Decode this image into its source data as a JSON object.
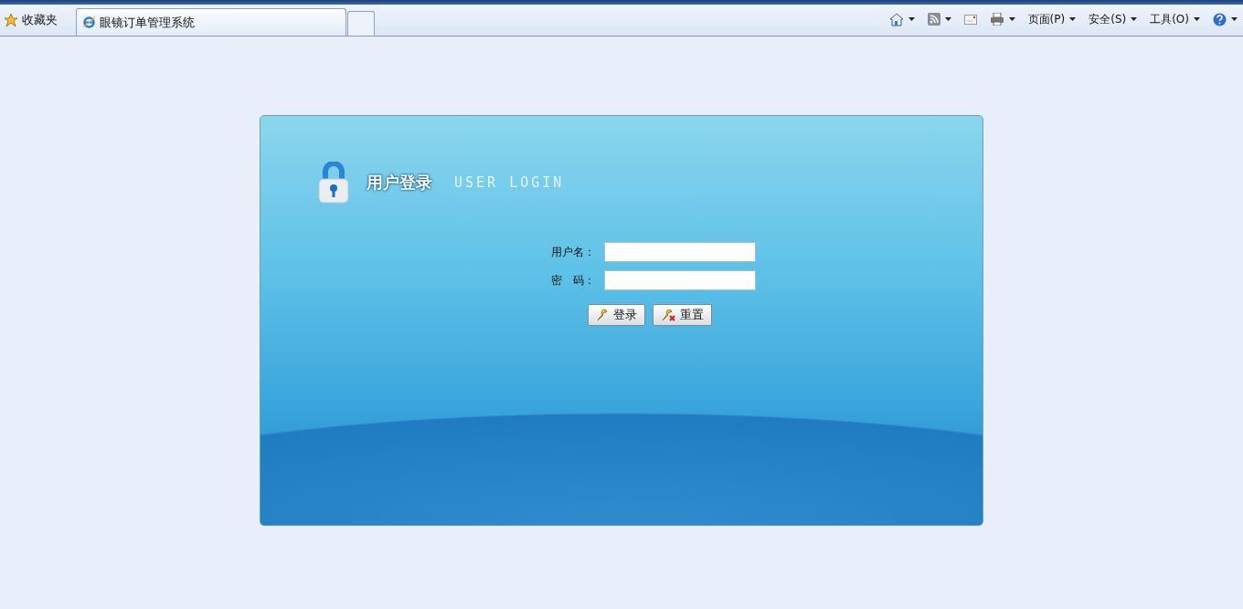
{
  "browser": {
    "favorites": "收藏夹",
    "tabs": [
      {
        "title": "眼镜订单管理系统",
        "selected": true
      }
    ],
    "toolbar": [
      {
        "kind": "icon",
        "dropdown": true
      },
      {
        "kind": "icon",
        "dropdown": true
      },
      {
        "kind": "icon",
        "dropdown": false
      },
      {
        "kind": "icon",
        "dropdown": true
      },
      {
        "kind": "menu",
        "label": "页面(P)"
      },
      {
        "kind": "menu",
        "label": "安全(S)"
      },
      {
        "kind": "menu",
        "label": "工具(O)"
      },
      {
        "kind": "icon",
        "dropdown": true
      }
    ]
  },
  "login": {
    "title": "用户登录",
    "subtitle": "USER LOGIN",
    "fields": [
      {
        "label": "用户名："
      },
      {
        "label": "密　码："
      }
    ],
    "buttons": [
      {
        "label": "登录",
        "kind": "login"
      },
      {
        "label": "重置",
        "kind": "reset"
      }
    ]
  }
}
